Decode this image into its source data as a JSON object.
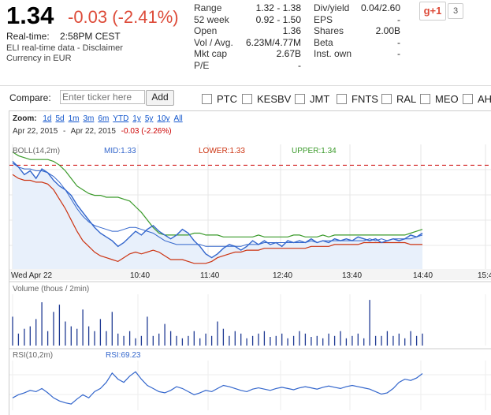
{
  "quote": {
    "price": "1.34",
    "change": "-0.03 (-2.41%)",
    "realtime_label": "Real-time:",
    "realtime_time": "2:58PM CEST",
    "source": "ELI real-time data - Disclaimer",
    "currency": "Currency in EUR"
  },
  "stats_left": [
    {
      "k": "Range",
      "v": "1.32 - 1.38"
    },
    {
      "k": "52 week",
      "v": "0.92 - 1.50"
    },
    {
      "k": "Open",
      "v": "1.36"
    },
    {
      "k": "Vol / Avg.",
      "v": "6.23M/4.77M"
    },
    {
      "k": "Mkt cap",
      "v": "2.67B"
    },
    {
      "k": "P/E",
      "v": "-"
    }
  ],
  "stats_right": [
    {
      "k": "Div/yield",
      "v": "0.04/2.60"
    },
    {
      "k": "EPS",
      "v": "-"
    },
    {
      "k": "Shares",
      "v": "2.00B"
    },
    {
      "k": "Beta",
      "v": "-"
    },
    {
      "k": "Inst. own",
      "v": "-"
    }
  ],
  "social": {
    "gplus_label": "g+1",
    "count": "3"
  },
  "compare": {
    "label": "Compare:",
    "placeholder": "Enter ticker here",
    "add_label": "Add",
    "tickers": [
      "PTC",
      "KESBV",
      "JMT",
      "FNTS",
      "RAL",
      "MEO",
      "AH"
    ]
  },
  "zoom": {
    "label": "Zoom:",
    "options": [
      "1d",
      "5d",
      "1m",
      "3m",
      "6m",
      "YTD",
      "1y",
      "5y",
      "10y",
      "All"
    ],
    "date_from": "Apr 22, 2015",
    "date_to": "Apr 22, 2015",
    "range_change": "-0.03 (-2.26%)"
  },
  "chart_data": {
    "type": "line",
    "x_ticks": [
      "Wed Apr 22",
      "10:40",
      "11:40",
      "12:40",
      "13:40",
      "14:40",
      "15:4"
    ],
    "indicator_labels": {
      "boll": "BOLL(14,2m)",
      "mid": "MID:1.33",
      "lower": "LOWER:1.33",
      "upper": "UPPER:1.34",
      "volume": "Volume (thous / 2min)",
      "rsi": "RSI(10,2m)",
      "rsi_value": "RSI:69.23"
    },
    "colors": {
      "price": "#3366cc",
      "upper": "#3a9a2a",
      "lower": "#cc3311",
      "mid": "#3366cc",
      "prev_close": "#cc0000",
      "volume": "#1f3a93",
      "rsi": "#3366cc"
    },
    "price": [
      1.375,
      1.372,
      1.368,
      1.37,
      1.366,
      1.371,
      1.369,
      1.365,
      1.362,
      1.36,
      1.357,
      1.352,
      1.348,
      1.344,
      1.34,
      1.337,
      1.335,
      1.333,
      1.33,
      1.332,
      1.335,
      1.338,
      1.336,
      1.339,
      1.341,
      1.338,
      1.336,
      1.334,
      1.336,
      1.339,
      1.337,
      1.333,
      1.33,
      1.326,
      1.324,
      1.326,
      1.329,
      1.331,
      1.33,
      1.328,
      1.33,
      1.333,
      1.331,
      1.333,
      1.331,
      1.332,
      1.33,
      1.333,
      1.332,
      1.333,
      1.332,
      1.334,
      1.332,
      1.333,
      1.332,
      1.334,
      1.333,
      1.334,
      1.333,
      1.335,
      1.334,
      1.333,
      1.334,
      1.332,
      1.333,
      1.334,
      1.333,
      1.334,
      1.336,
      1.335,
      1.337
    ],
    "upper": [
      1.38,
      1.378,
      1.377,
      1.376,
      1.376,
      1.376,
      1.376,
      1.375,
      1.373,
      1.37,
      1.366,
      1.362,
      1.36,
      1.358,
      1.357,
      1.357,
      1.356,
      1.356,
      1.356,
      1.355,
      1.354,
      1.351,
      1.348,
      1.344,
      1.34,
      1.337,
      1.336,
      1.336,
      1.336,
      1.336,
      1.336,
      1.337,
      1.337,
      1.336,
      1.336,
      1.336,
      1.335,
      1.335,
      1.335,
      1.335,
      1.335,
      1.335,
      1.336,
      1.335,
      1.335,
      1.335,
      1.335,
      1.335,
      1.336,
      1.336,
      1.335,
      1.335,
      1.335,
      1.336,
      1.335,
      1.336,
      1.336,
      1.336,
      1.336,
      1.336,
      1.336,
      1.336,
      1.336,
      1.336,
      1.336,
      1.336,
      1.336,
      1.336,
      1.337,
      1.338,
      1.339
    ],
    "mid": [
      1.374,
      1.372,
      1.371,
      1.371,
      1.37,
      1.37,
      1.369,
      1.367,
      1.364,
      1.36,
      1.355,
      1.35,
      1.346,
      1.343,
      1.341,
      1.34,
      1.339,
      1.338,
      1.338,
      1.339,
      1.34,
      1.34,
      1.339,
      1.338,
      1.337,
      1.335,
      1.333,
      1.332,
      1.331,
      1.331,
      1.331,
      1.331,
      1.331,
      1.33,
      1.33,
      1.33,
      1.33,
      1.33,
      1.33,
      1.33,
      1.331,
      1.331,
      1.331,
      1.332,
      1.332,
      1.332,
      1.332,
      1.332,
      1.332,
      1.332,
      1.332,
      1.333,
      1.332,
      1.333,
      1.333,
      1.333,
      1.333,
      1.333,
      1.333,
      1.333,
      1.333,
      1.334,
      1.333,
      1.334,
      1.333,
      1.334,
      1.334,
      1.334,
      1.334,
      1.335,
      1.336
    ],
    "lower": [
      1.368,
      1.366,
      1.365,
      1.365,
      1.364,
      1.364,
      1.363,
      1.36,
      1.355,
      1.35,
      1.344,
      1.338,
      1.333,
      1.33,
      1.327,
      1.325,
      1.324,
      1.323,
      1.322,
      1.324,
      1.326,
      1.327,
      1.326,
      1.327,
      1.328,
      1.327,
      1.325,
      1.323,
      1.323,
      1.323,
      1.322,
      1.321,
      1.321,
      1.321,
      1.322,
      1.324,
      1.325,
      1.326,
      1.327,
      1.327,
      1.328,
      1.328,
      1.328,
      1.329,
      1.329,
      1.329,
      1.329,
      1.329,
      1.329,
      1.329,
      1.329,
      1.33,
      1.33,
      1.33,
      1.33,
      1.331,
      1.331,
      1.331,
      1.331,
      1.331,
      1.332,
      1.332,
      1.332,
      1.332,
      1.332,
      1.332,
      1.332,
      1.332,
      1.331,
      1.331,
      1.331
    ],
    "prev_close": 1.373,
    "y_range": [
      1.318,
      1.384
    ],
    "volume": [
      60,
      25,
      35,
      40,
      55,
      90,
      30,
      70,
      85,
      50,
      40,
      35,
      75,
      40,
      30,
      55,
      30,
      70,
      25,
      20,
      30,
      15,
      20,
      60,
      20,
      25,
      45,
      30,
      20,
      15,
      20,
      30,
      15,
      25,
      20,
      50,
      35,
      20,
      30,
      25,
      15,
      20,
      25,
      30,
      18,
      20,
      25,
      15,
      20,
      30,
      25,
      18,
      20,
      15,
      25,
      20,
      30,
      15,
      20,
      25,
      15,
      95,
      20,
      20,
      30,
      20,
      25,
      15,
      30,
      20,
      25
    ],
    "rsi": [
      30,
      35,
      38,
      42,
      40,
      45,
      38,
      30,
      25,
      22,
      20,
      28,
      35,
      30,
      40,
      45,
      55,
      70,
      60,
      55,
      65,
      72,
      60,
      50,
      45,
      40,
      38,
      42,
      48,
      45,
      40,
      35,
      38,
      42,
      40,
      45,
      50,
      48,
      45,
      42,
      40,
      44,
      46,
      44,
      42,
      45,
      47,
      45,
      43,
      46,
      48,
      46,
      44,
      47,
      49,
      47,
      45,
      48,
      50,
      48,
      46,
      44,
      40,
      36,
      38,
      45,
      55,
      60,
      58,
      62,
      69
    ]
  }
}
